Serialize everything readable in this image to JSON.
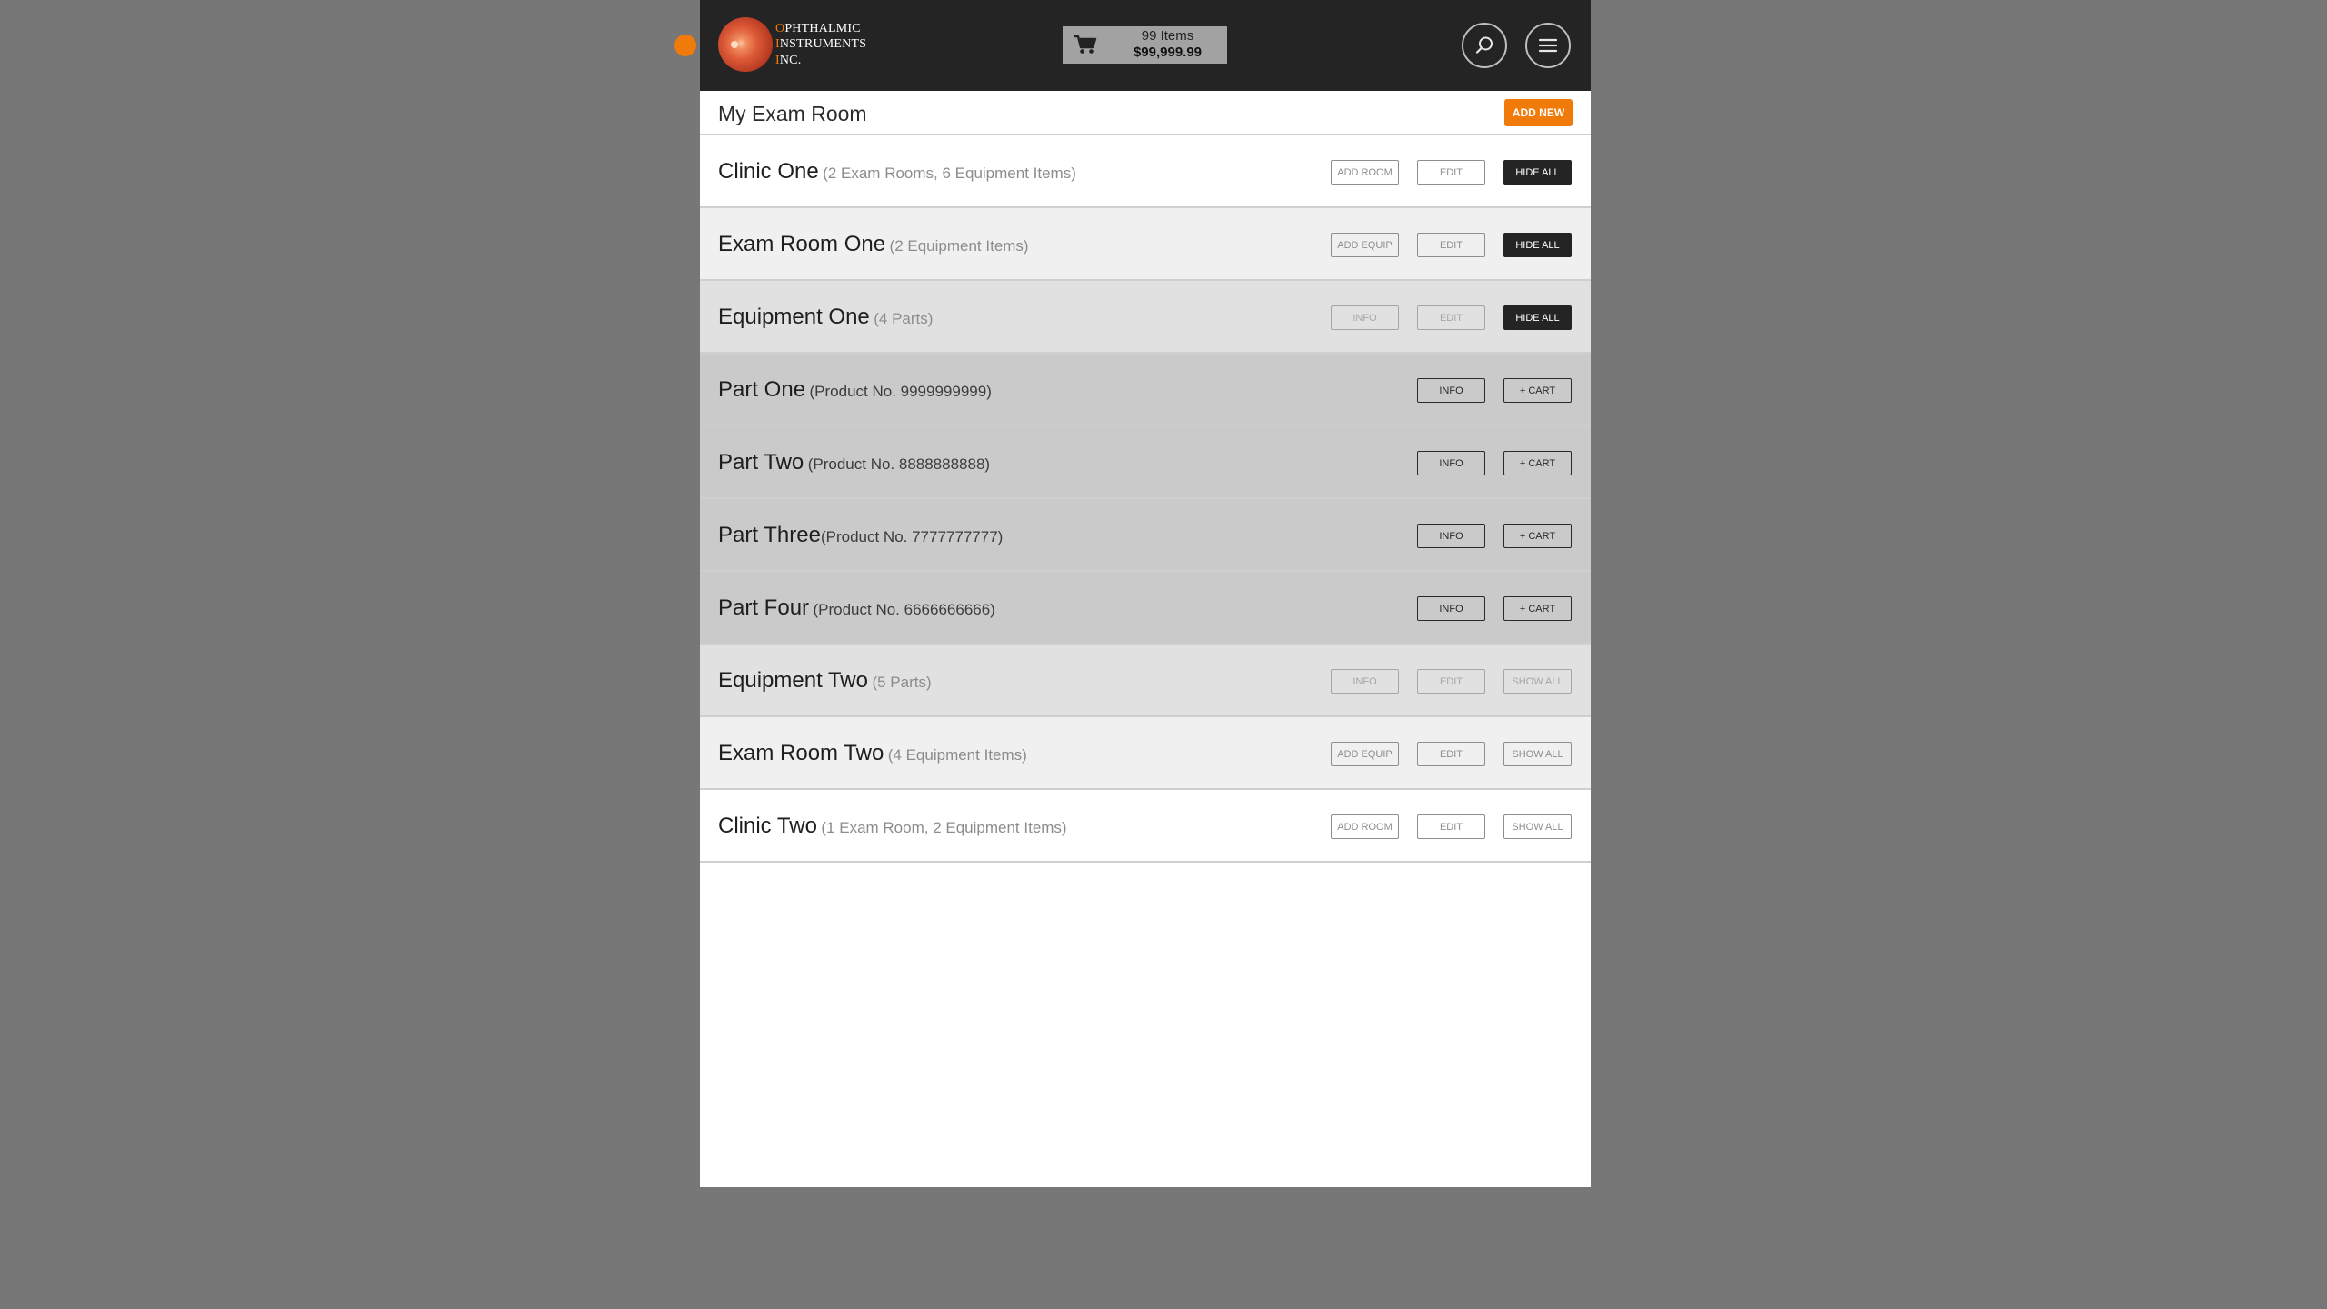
{
  "header": {
    "logo": {
      "line1_first": "O",
      "line1_rest": "PHTHALMIC",
      "line2_first": "I",
      "line2_rest": "NSTRUMENTS",
      "line3_first": "I",
      "line3_rest": "NC."
    },
    "cart": {
      "count_label": "99 Items",
      "total_label": "$99,999.99"
    }
  },
  "page": {
    "title": "My Exam Room",
    "add_new_label": "ADD NEW"
  },
  "rows": [
    {
      "name": "Clinic One",
      "detail": "(2 Exam Rooms, 6 Equipment Items)",
      "buttons": [
        "ADD ROOM",
        "EDIT",
        "HIDE ALL"
      ]
    },
    {
      "name": "Exam Room One",
      "detail": "(2 Equipment Items)",
      "buttons": [
        "ADD EQUIP",
        "EDIT",
        "HIDE ALL"
      ]
    },
    {
      "name": "Equipment One",
      "detail": "(4 Parts)",
      "buttons": [
        "INFO",
        "EDIT",
        "HIDE ALL"
      ]
    },
    {
      "name": "Part One",
      "detail": "(Product No. 9999999999)",
      "buttons": [
        "INFO",
        "+ CART"
      ]
    },
    {
      "name": "Part Two",
      "detail": "(Product No. 8888888888)",
      "buttons": [
        "INFO",
        "+ CART"
      ]
    },
    {
      "name": "Part Three",
      "detail": "(Product No. 7777777777)",
      "buttons": [
        "INFO",
        "+ CART"
      ]
    },
    {
      "name": "Part Four",
      "detail": "(Product No. 6666666666)",
      "buttons": [
        "INFO",
        "+ CART"
      ]
    },
    {
      "name": "Equipment Two",
      "detail": "(5 Parts)",
      "buttons": [
        "INFO",
        "EDIT",
        "SHOW ALL"
      ]
    },
    {
      "name": "Exam Room Two",
      "detail": "(4 Equipment Items)",
      "buttons": [
        "ADD EQUIP",
        "EDIT",
        "SHOW ALL"
      ]
    },
    {
      "name": "Clinic Two",
      "detail": "(1 Exam Room, 2 Equipment Items)",
      "buttons": [
        "ADD ROOM",
        "EDIT",
        "SHOW ALL"
      ]
    }
  ],
  "colors": {
    "accent": "#f07a0a",
    "header_bg": "#242424",
    "page_bg": "#777777"
  },
  "icons": {
    "cart": "shopping-cart-icon",
    "search": "search-icon",
    "menu": "hamburger-menu-icon"
  }
}
